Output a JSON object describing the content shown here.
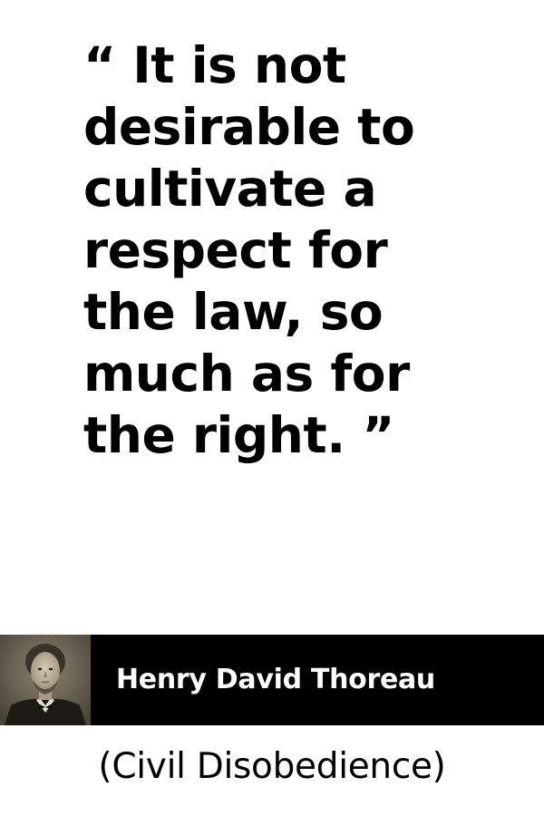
{
  "quote": {
    "lines": [
      "“ It is not",
      "desirable to",
      "cultivate a",
      "respect for",
      "the law, so",
      "much as for",
      "the right. ”"
    ]
  },
  "author": {
    "name": "Henry David Thoreau",
    "portrait_icon": "author-portrait"
  },
  "source": {
    "title": "(Civil Disobedience)"
  },
  "colors": {
    "background": "#ffffff",
    "author_bar": "#000000",
    "author_text": "#ffffff",
    "quote_text": "#000000"
  }
}
